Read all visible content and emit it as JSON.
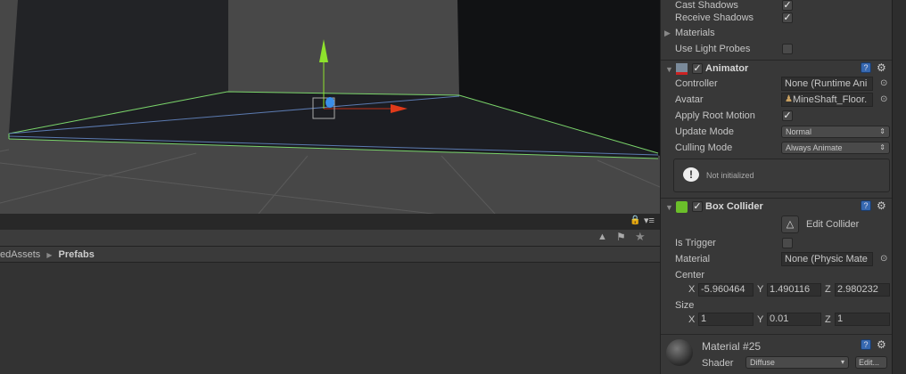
{
  "scene": {
    "colors": {
      "y_axis": "#8ee22c",
      "x_axis": "#e03a1a",
      "z_handle": "#3a8ee8",
      "selection_outline": "#7ad46a"
    }
  },
  "project": {
    "breadcrumb": [
      "edAssets",
      "Prefabs"
    ],
    "search_placeholder": "",
    "icons": [
      "lock-icon",
      "menu-icon",
      "search-icon",
      "filter-by-type-icon",
      "filter-by-label-icon",
      "favorites-icon"
    ]
  },
  "inspector": {
    "renderer": {
      "cast_shadows": "Cast Shadows",
      "cast_shadows_checked": true,
      "receive_shadows": "Receive Shadows",
      "receive_shadows_checked": true,
      "materials": "Materials",
      "use_light_probes": "Use Light Probes",
      "use_light_probes_checked": false
    },
    "animator": {
      "title": "Animator",
      "enabled": true,
      "controller_label": "Controller",
      "controller_value": "None (Runtime Ani",
      "avatar_label": "Avatar",
      "avatar_value": "MineShaft_Floor.",
      "apply_root_motion_label": "Apply Root Motion",
      "apply_root_motion": true,
      "update_mode_label": "Update Mode",
      "update_mode": "Normal",
      "culling_mode_label": "Culling Mode",
      "culling_mode": "Always Animate",
      "help": "Not initialized"
    },
    "box_collider": {
      "title": "Box Collider",
      "enabled": true,
      "edit_collider": "Edit Collider",
      "is_trigger_label": "Is Trigger",
      "is_trigger": false,
      "material_label": "Material",
      "material_value": "None (Physic Mate",
      "center_label": "Center",
      "center": {
        "x": "-5.960464",
        "y": "1.490116",
        "z": "2.980232"
      },
      "size_label": "Size",
      "size": {
        "x": "1",
        "y": "0.01",
        "z": "1"
      }
    },
    "material": {
      "title": "Material #25",
      "shader_label": "Shader",
      "shader": "Diffuse",
      "edit": "Edit..."
    }
  },
  "axis_labels": {
    "x": "X",
    "y": "Y",
    "z": "Z"
  }
}
